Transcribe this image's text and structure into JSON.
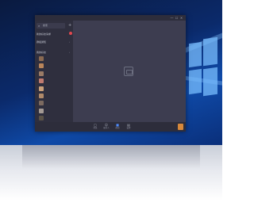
{
  "app": {
    "title": "",
    "window_controls": {
      "minimize": "—",
      "maximize": "☐",
      "close": "✕"
    }
  },
  "sidebar": {
    "search": {
      "icon": "search-icon",
      "placeholder": "搜索"
    },
    "add_icon": "plus-icon",
    "rows": [
      {
        "label": "新的好友请求"
      },
      {
        "label": "群组通知"
      },
      {
        "label": "我的好友"
      }
    ],
    "contacts": [
      {
        "name": "",
        "color": "#8a6a52"
      },
      {
        "name": "",
        "color": "#b9855a"
      },
      {
        "name": "",
        "color": "#9a7b66"
      },
      {
        "name": "",
        "color": "#c07b70"
      },
      {
        "name": "",
        "color": "#c9a07a"
      },
      {
        "name": "",
        "color": "#b08a6a"
      },
      {
        "name": "",
        "color": "#7c6a60"
      },
      {
        "name": "",
        "color": "#a49a94"
      },
      {
        "name": "",
        "color": "#5b5348"
      }
    ]
  },
  "main": {
    "empty_icon": "chat-placeholder-icon"
  },
  "bottom_nav": [
    {
      "icon": "message-icon",
      "label": "消息"
    },
    {
      "icon": "contacts-icon",
      "label": "联系人"
    },
    {
      "icon": "group-icon",
      "label": "群组"
    },
    {
      "icon": "settings-icon",
      "label": "设置"
    }
  ]
}
